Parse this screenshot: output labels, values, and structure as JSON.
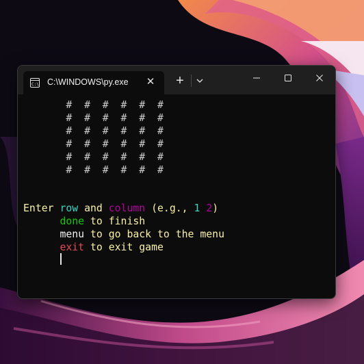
{
  "window": {
    "tab_title": "C:\\WINDOWS\\py.exe",
    "tab_icon": "terminal-icon",
    "new_tab_glyph": "+",
    "dropdown_glyph": "⌄",
    "min_glyph": "—",
    "max_glyph": "☐",
    "close_glyph": "✕",
    "tab_close_glyph": "✕"
  },
  "terminal": {
    "grid_rows": [
      "       #  #  #  #  #  #",
      "       #  #  #  #  #  #",
      "       #  #  #  #  #  #",
      "       #  #  #  #  #  #",
      "       #  #  #  #  #  #",
      "       #  #  #  #  #  #"
    ],
    "prompt": {
      "enter": "Enter ",
      "row": "row",
      "and": " and ",
      "column": "column",
      "eg_open": " (e.g., ",
      "one": "1",
      "space": " ",
      "two": "2",
      "eg_close": ")"
    },
    "done_line": {
      "indent": "      ",
      "keyword": "done",
      "rest": " to finish"
    },
    "menu_line": {
      "indent": "      ",
      "keyword": "menu",
      "rest": " to go back to the menu"
    },
    "exit_line": {
      "indent": "      ",
      "keyword": "exit",
      "rest": " to exit game"
    }
  }
}
